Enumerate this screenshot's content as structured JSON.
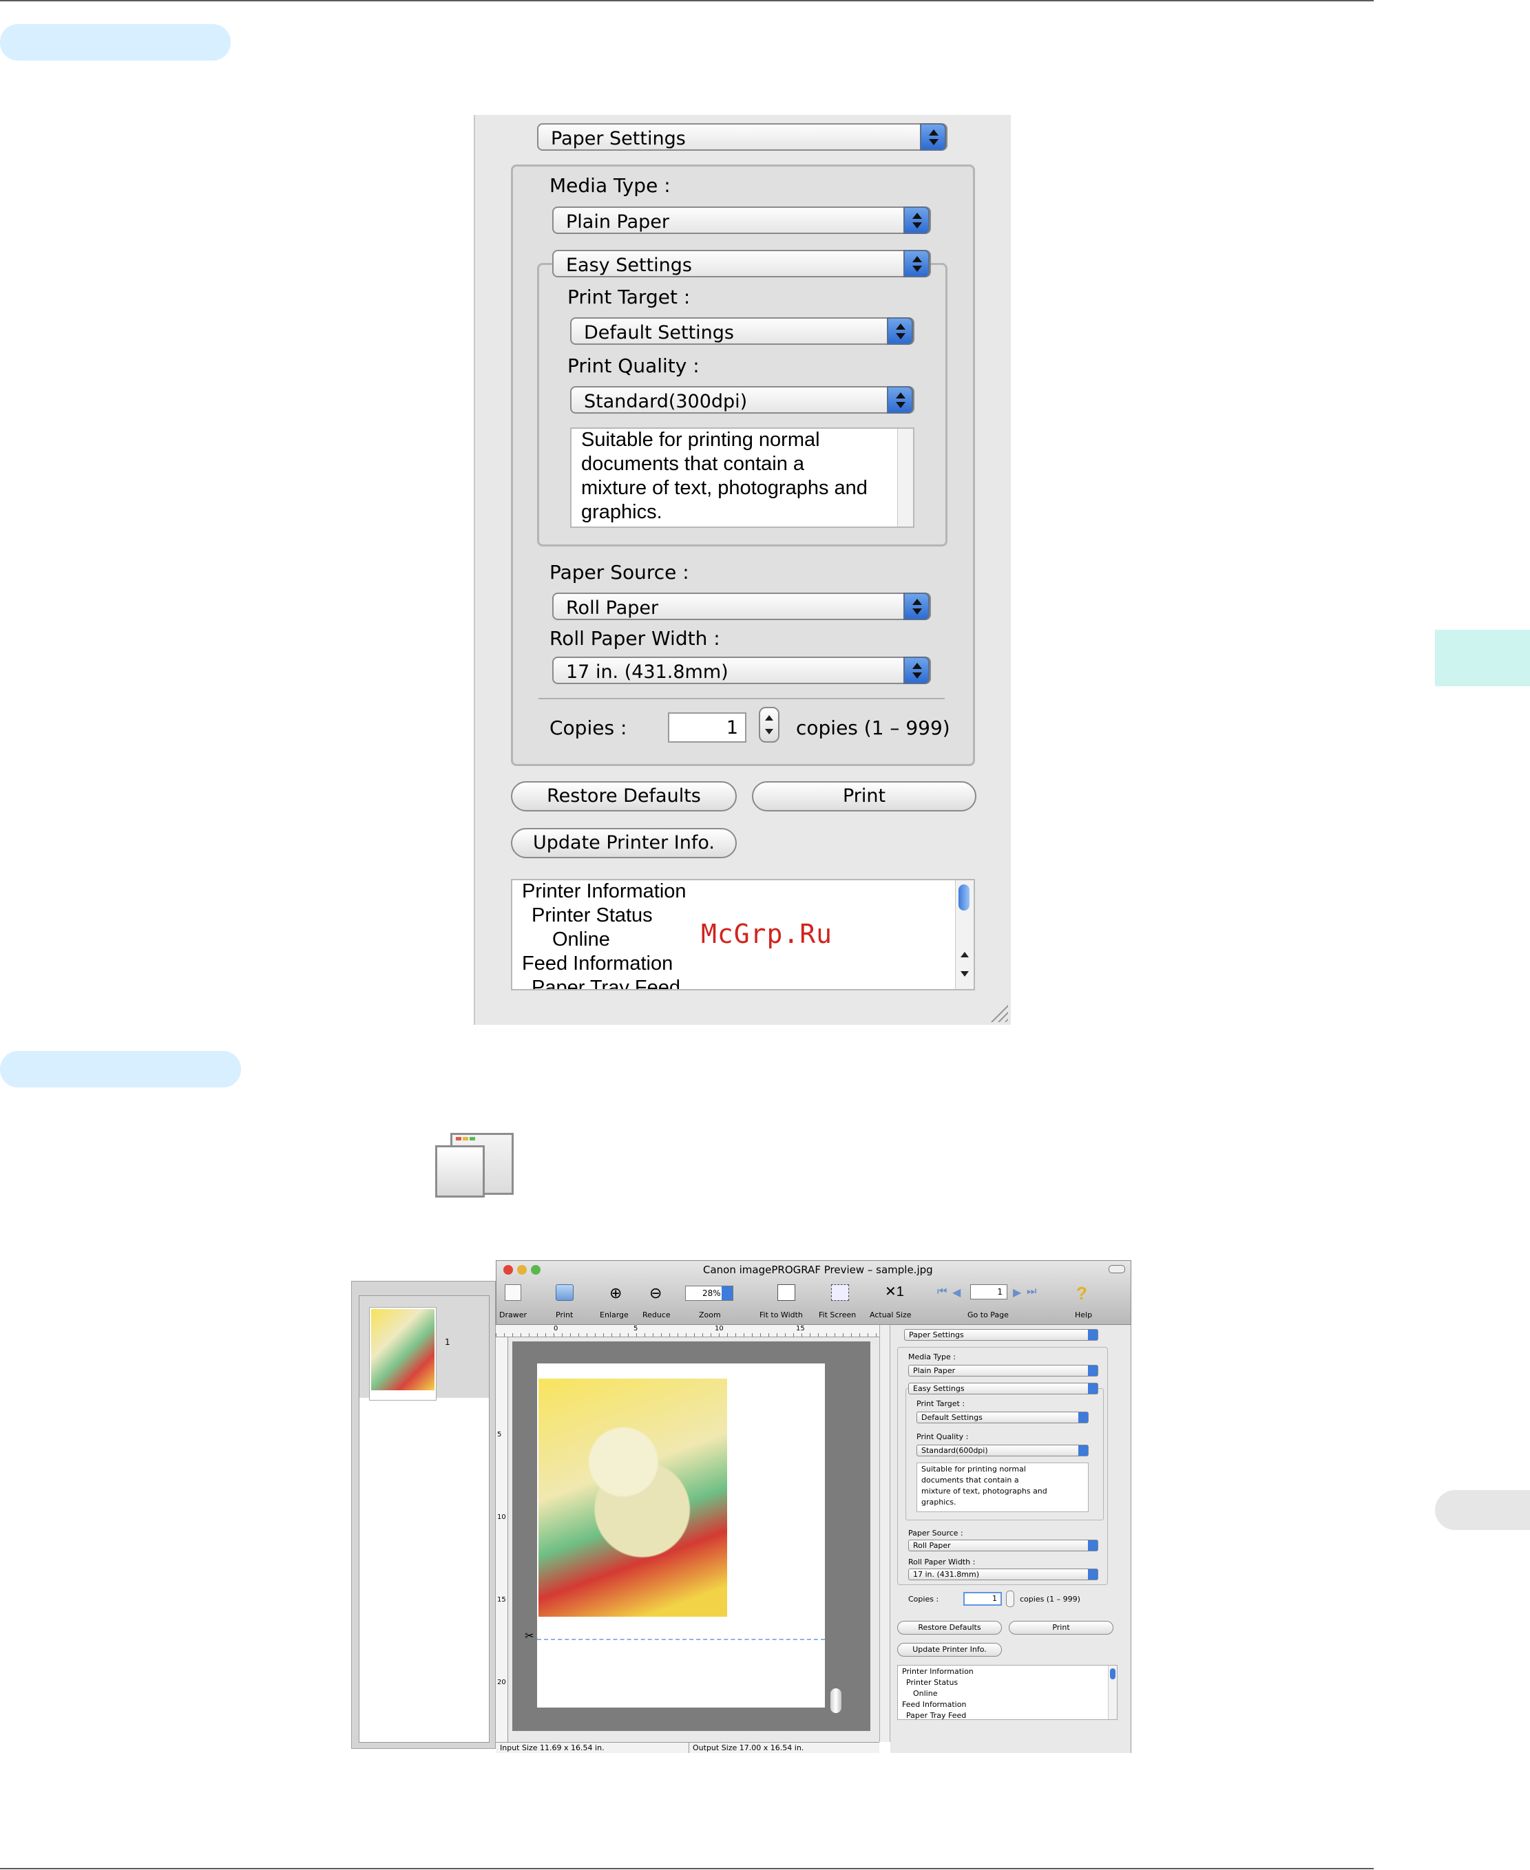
{
  "panel1": {
    "top_menu": "Paper Settings",
    "media_type_label": "Media Type :",
    "media_type": "Plain Paper",
    "easy_settings": "Easy Settings",
    "print_target_label": "Print Target :",
    "print_target": "Default Settings",
    "print_quality_label": "Print Quality :",
    "print_quality": "Standard(300dpi)",
    "description": [
      "Suitable for printing normal",
      "documents that contain a",
      "mixture of text, photographs and",
      "graphics."
    ],
    "paper_source_label": "Paper Source :",
    "paper_source": "Roll Paper",
    "roll_width_label": "Roll Paper Width :",
    "roll_width": "17 in. (431.8mm)",
    "copies_label": "Copies :",
    "copies_value": "1",
    "copies_range": "copies (1 – 999)",
    "restore_defaults": "Restore Defaults",
    "print": "Print",
    "update_printer_info": "Update Printer Info.",
    "info": [
      "Printer Information",
      "Printer Status",
      "Online",
      "Feed Information",
      "Paper Tray Feed"
    ],
    "watermark": "McGrp.Ru"
  },
  "preview": {
    "title": "Canon imagePROGRAF Preview – sample.jpg",
    "toolbar": {
      "drawer": "Drawer",
      "print": "Print",
      "enlarge": "Enlarge",
      "reduce": "Reduce",
      "zoom_value": "28%",
      "zoom": "Zoom",
      "fit_width": "Fit to Width",
      "fit_screen": "Fit Screen",
      "actual_size": "Actual Size",
      "page_value": "1",
      "go_to_page": "Go to Page",
      "help": "Help"
    },
    "thumb_page": "1",
    "ruler_top": [
      "0",
      "5",
      "10",
      "15"
    ],
    "ruler_left": [
      "5",
      "10",
      "15",
      "20"
    ],
    "status_input": "Input Size 11.69 x 16.54 in.",
    "status_output": "Output Size 17.00 x 16.54 in.",
    "side": {
      "top_menu": "Paper Settings",
      "media_type_label": "Media Type :",
      "media_type": "Plain Paper",
      "easy_settings": "Easy Settings",
      "print_target_label": "Print Target :",
      "print_target": "Default Settings",
      "print_quality_label": "Print Quality :",
      "print_quality": "Standard(600dpi)",
      "description": [
        "Suitable for printing normal",
        "documents that contain a",
        "mixture of text, photographs and",
        "graphics."
      ],
      "paper_source_label": "Paper Source :",
      "paper_source": "Roll Paper",
      "roll_width_label": "Roll Paper Width :",
      "roll_width": "17 in. (431.8mm)",
      "copies_label": "Copies :",
      "copies_value": "1",
      "copies_range": "copies (1 – 999)",
      "restore_defaults": "Restore Defaults",
      "print": "Print",
      "update_printer_info": "Update Printer Info.",
      "info": [
        "Printer Information",
        "Printer Status",
        "Online",
        "Feed Information",
        "Paper Tray Feed"
      ]
    }
  },
  "colors": {
    "pill": "#d8efff",
    "side_tab_green": "#cdf4ef",
    "side_tab_grey": "#e6e6e6",
    "stepper_blue": "#3d7bdc"
  }
}
